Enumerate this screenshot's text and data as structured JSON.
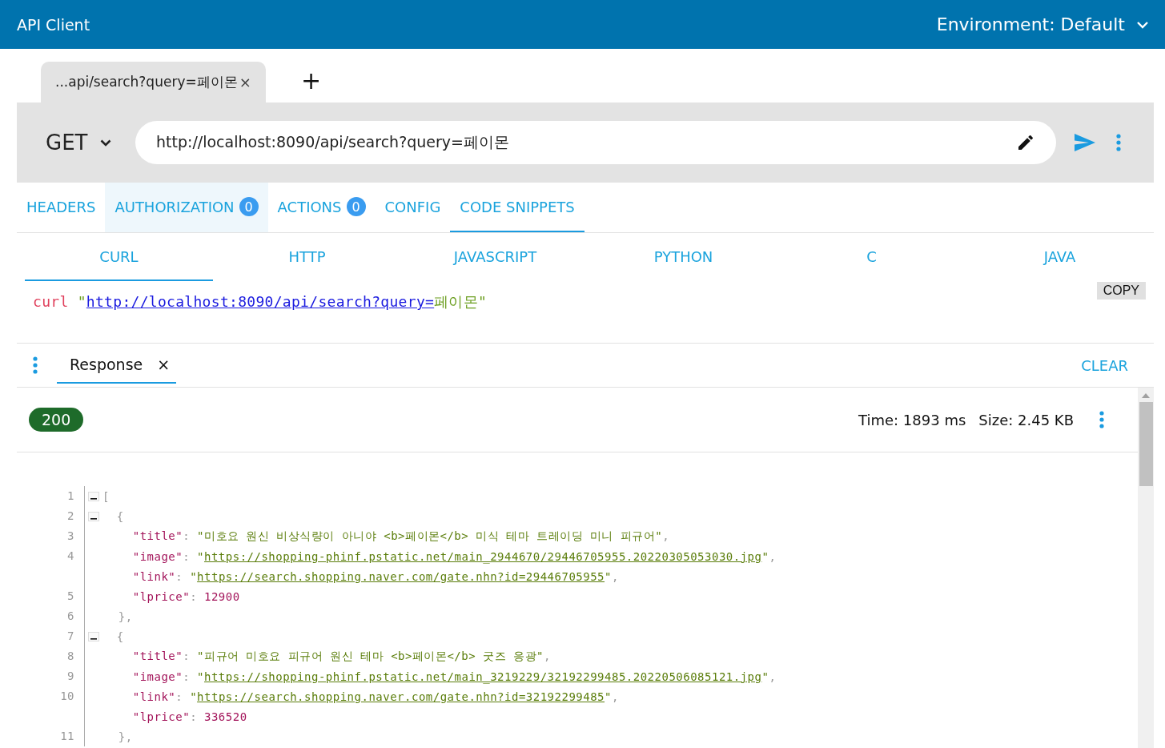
{
  "app_bar": {
    "title": "API Client",
    "environment": "Environment: Default"
  },
  "request_tabs": [
    {
      "label": "...api/search?query=페이몬",
      "close": "×",
      "selected": true
    }
  ],
  "new_tab": "+",
  "request": {
    "method": "GET",
    "url": "http://localhost:8090/api/search?query=페이몬"
  },
  "section_tabs": [
    {
      "label": "HEADERS",
      "selected": false,
      "hovered": false
    },
    {
      "label": "AUTHORIZATION",
      "count": "0",
      "selected": false,
      "hovered": true
    },
    {
      "label": "ACTIONS",
      "count": "0",
      "selected": false,
      "hovered": false
    },
    {
      "label": "CONFIG",
      "selected": false,
      "hovered": false
    },
    {
      "label": "CODE SNIPPETS",
      "selected": true,
      "hovered": false
    }
  ],
  "snippet_tabs": [
    {
      "label": "CURL",
      "selected": true
    },
    {
      "label": "HTTP",
      "selected": false
    },
    {
      "label": "JAVASCRIPT",
      "selected": false
    },
    {
      "label": "PYTHON",
      "selected": false
    },
    {
      "label": "C",
      "selected": false
    },
    {
      "label": "JAVA",
      "selected": false
    }
  ],
  "snippet": {
    "tokens": [
      {
        "kind": "command",
        "text": "curl "
      },
      {
        "kind": "string",
        "text": "\""
      },
      {
        "kind": "url",
        "text": "http://localhost:8090/api/search?query="
      },
      {
        "kind": "string",
        "text": "페이몬\""
      }
    ],
    "copy": "COPY"
  },
  "response_tabs": [
    {
      "label": "Response",
      "close": "×",
      "selected": true
    }
  ],
  "clear": "CLEAR",
  "status": {
    "code": "200",
    "time": "Time: 1893 ms",
    "size": "Size: 2.45 KB"
  },
  "code_lines": [
    {
      "number": "1",
      "fold": true,
      "tokens": [
        {
          "kind": "punct",
          "text": "["
        }
      ]
    },
    {
      "number": "2",
      "fold": true,
      "tokens": [
        {
          "kind": "punct",
          "text": "  {"
        }
      ]
    },
    {
      "number": "3",
      "fold": false,
      "tokens": [
        {
          "kind": "key",
          "text": "    \"title\""
        },
        {
          "kind": "punct",
          "text": ": "
        },
        {
          "kind": "string",
          "text": "\"미호요 원신 비상식량이 아니야 <b>페이몬</b> 미식 테마 트레이딩 미니 피규어\""
        },
        {
          "kind": "punct",
          "text": ","
        }
      ]
    },
    {
      "number": "4",
      "fold": false,
      "tokens": [
        {
          "kind": "key",
          "text": "    \"image\""
        },
        {
          "kind": "punct",
          "text": ": "
        },
        {
          "kind": "string",
          "text": "\""
        },
        {
          "kind": "link",
          "text": "https://shopping-phinf.pstatic.net/main_2944670/29446705955.20220305053030.jpg"
        },
        {
          "kind": "string",
          "text": "\""
        },
        {
          "kind": "punct",
          "text": ","
        }
      ]
    },
    {
      "fold": false,
      "tokens": [
        {
          "kind": "key",
          "text": "    \"link\""
        },
        {
          "kind": "punct",
          "text": ": "
        },
        {
          "kind": "string",
          "text": "\""
        },
        {
          "kind": "link",
          "text": "https://search.shopping.naver.com/gate.nhn?id=29446705955"
        },
        {
          "kind": "string",
          "text": "\""
        },
        {
          "kind": "punct",
          "text": ","
        }
      ]
    },
    {
      "number": "5",
      "fold": false,
      "tokens": [
        {
          "kind": "key",
          "text": "    \"lprice\""
        },
        {
          "kind": "punct",
          "text": ": "
        },
        {
          "kind": "number",
          "text": "12900"
        }
      ]
    },
    {
      "number": "6",
      "fold": false,
      "tokens": [
        {
          "kind": "punct",
          "text": "  },"
        }
      ]
    },
    {
      "number": "7",
      "fold": true,
      "tokens": [
        {
          "kind": "punct",
          "text": "  {"
        }
      ]
    },
    {
      "number": "8",
      "fold": false,
      "tokens": [
        {
          "kind": "key",
          "text": "    \"title\""
        },
        {
          "kind": "punct",
          "text": ": "
        },
        {
          "kind": "string",
          "text": "\"피규어 미호요 피규어 원신 테마 <b>페이몬</b> 굿즈 응광\""
        },
        {
          "kind": "punct",
          "text": ","
        }
      ]
    },
    {
      "number": "9",
      "fold": false,
      "tokens": [
        {
          "kind": "key",
          "text": "    \"image\""
        },
        {
          "kind": "punct",
          "text": ": "
        },
        {
          "kind": "string",
          "text": "\""
        },
        {
          "kind": "link",
          "text": "https://shopping-phinf.pstatic.net/main_3219229/32192299485.20220506085121.jpg"
        },
        {
          "kind": "string",
          "text": "\""
        },
        {
          "kind": "punct",
          "text": ","
        }
      ]
    },
    {
      "number": "10",
      "fold": false,
      "tokens": [
        {
          "kind": "key",
          "text": "    \"link\""
        },
        {
          "kind": "punct",
          "text": ": "
        },
        {
          "kind": "string",
          "text": "\""
        },
        {
          "kind": "link",
          "text": "https://search.shopping.naver.com/gate.nhn?id=32192299485"
        },
        {
          "kind": "string",
          "text": "\""
        },
        {
          "kind": "punct",
          "text": ","
        }
      ]
    },
    {
      "fold": false,
      "tokens": [
        {
          "kind": "key",
          "text": "    \"lprice\""
        },
        {
          "kind": "punct",
          "text": ": "
        },
        {
          "kind": "number",
          "text": "336520"
        }
      ]
    },
    {
      "number": "11",
      "fold": false,
      "tokens": [
        {
          "kind": "punct",
          "text": "  },"
        }
      ]
    }
  ]
}
